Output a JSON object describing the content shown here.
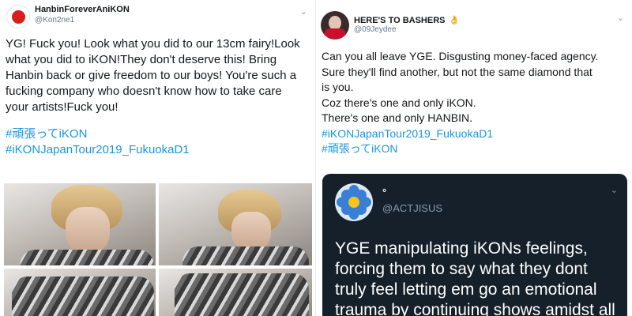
{
  "left_tweet": {
    "display_name": "HanbinForeverAniKON",
    "handle": "@Kon2ne1",
    "body_lines": [
      "YG! Fuck you! Look what you did to our 13cm fairy!Look",
      "what you did to iKON!They don't deserve this! Bring",
      "Hanbin back or give freedom to our boys! You're such a",
      "fucking company who doesn't know how to take care",
      "your artists!Fuck you!"
    ],
    "hashtags": [
      "#頑張ってiKON",
      "#iKONJapanTour2019_FukuokaD1"
    ],
    "caret_icon": "chevron-down-icon",
    "avatar_color": "#d81e1e"
  },
  "right_tweet": {
    "display_name": "HERE'S TO BASHERS",
    "name_emoji": "👌",
    "handle": "@09Jeydee",
    "body_lines": [
      "Can you all leave YGE. Disgusting money-faced agency.",
      "Sure they'll find another, but not the same diamond that",
      "is you.",
      "Coz there's one and only iKON.",
      "There's one and only HANBIN."
    ],
    "hashtags": [
      "#iKONJapanTour2019_FukuokaD1",
      "#頑張ってiKON"
    ],
    "caret_icon": "chevron-down-icon"
  },
  "quoted_tweet": {
    "display_name": "°",
    "handle": "@ACTJISUS",
    "body_lines": [
      "YGE manipulating iKONs feelings,",
      "forcing them to say what they dont",
      "truly feel letting em go an emotional",
      "trauma by continuing shows amidst all"
    ],
    "caret_icon": "chevron-down-icon",
    "avatar_icon": "flower-icon",
    "background_color": "#15202b"
  },
  "colors": {
    "hashtag": "#1b95e0",
    "text": "#14171a",
    "muted": "#657786"
  }
}
